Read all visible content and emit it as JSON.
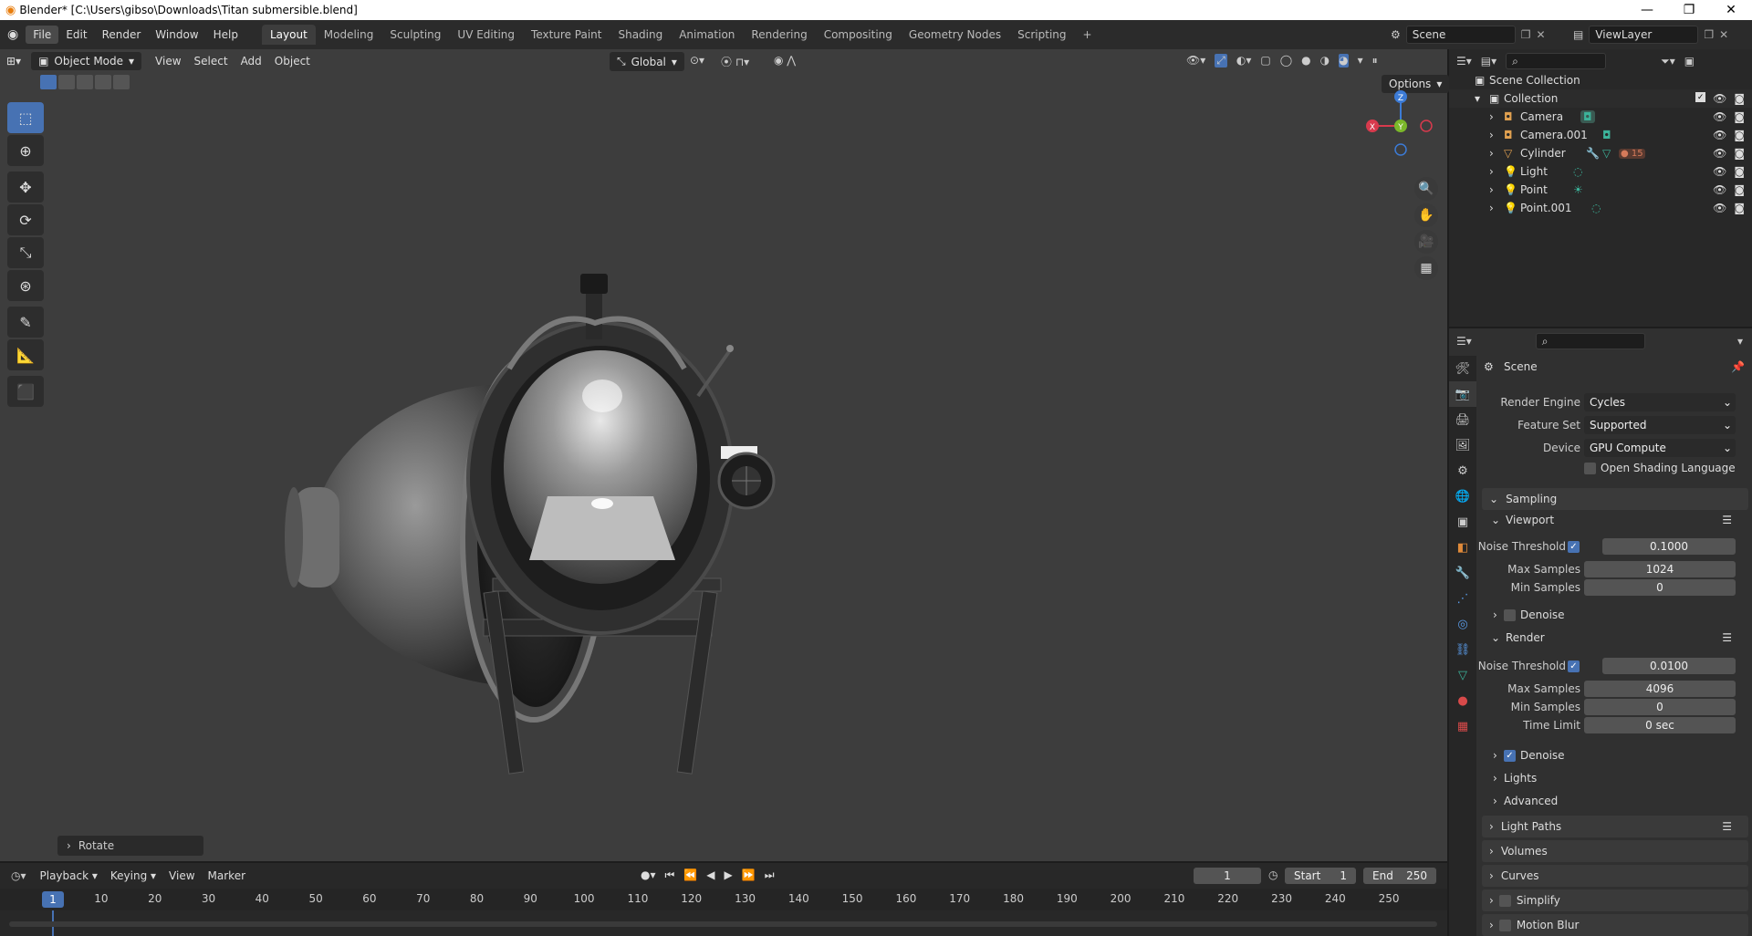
{
  "titlebar": {
    "title": "Blender* [C:\\Users\\gibso\\Downloads\\Titan submersible.blend]"
  },
  "menu": [
    "File",
    "Edit",
    "Render",
    "Window",
    "Help"
  ],
  "workspaces": [
    "Layout",
    "Modeling",
    "Sculpting",
    "UV Editing",
    "Texture Paint",
    "Shading",
    "Animation",
    "Rendering",
    "Compositing",
    "Geometry Nodes",
    "Scripting"
  ],
  "scene_field": "Scene",
  "viewlayer_field": "ViewLayer",
  "viewport": {
    "mode": "Object Mode",
    "menus": [
      "View",
      "Select",
      "Add",
      "Object"
    ],
    "orientation": "Global",
    "options": "Options",
    "last_op": "Rotate",
    "gizmo": {
      "z": "Z",
      "y": "Y",
      "x": "X"
    }
  },
  "outliner": {
    "root": "Scene Collection",
    "collection": "Collection",
    "objects": [
      "Camera",
      "Camera.001",
      "Cylinder",
      "Light",
      "Point",
      "Point.001"
    ],
    "cylinder_badge": "15"
  },
  "properties": {
    "context": "Scene",
    "render_engine_label": "Render Engine",
    "render_engine": "Cycles",
    "feature_set_label": "Feature Set",
    "feature_set": "Supported",
    "device_label": "Device",
    "device": "GPU Compute",
    "osl": "Open Shading Language",
    "sampling": "Sampling",
    "viewport": "Viewport",
    "noise_threshold": "Noise Threshold",
    "vp_noise": "0.1000",
    "max_samples": "Max Samples",
    "vp_max": "1024",
    "min_samples": "Min Samples",
    "vp_min": "0",
    "denoise": "Denoise",
    "render": "Render",
    "r_noise": "0.0100",
    "r_max": "4096",
    "r_min": "0",
    "time_limit": "Time Limit",
    "r_time": "0 sec",
    "lights": "Lights",
    "advanced": "Advanced",
    "light_paths": "Light Paths",
    "volumes": "Volumes",
    "curves": "Curves",
    "simplify": "Simplify",
    "motion_blur": "Motion Blur"
  },
  "timeline": {
    "menus": [
      "Playback",
      "Keying",
      "View",
      "Marker"
    ],
    "current_frame": "1",
    "start_label": "Start",
    "start": "1",
    "end_label": "End",
    "end": "250",
    "ticks": [
      "10",
      "20",
      "30",
      "40",
      "50",
      "60",
      "70",
      "80",
      "90",
      "100",
      "110",
      "120",
      "130",
      "140",
      "150",
      "160",
      "170",
      "180",
      "190",
      "200",
      "210",
      "220",
      "230",
      "240",
      "250"
    ],
    "playhead": "1"
  }
}
